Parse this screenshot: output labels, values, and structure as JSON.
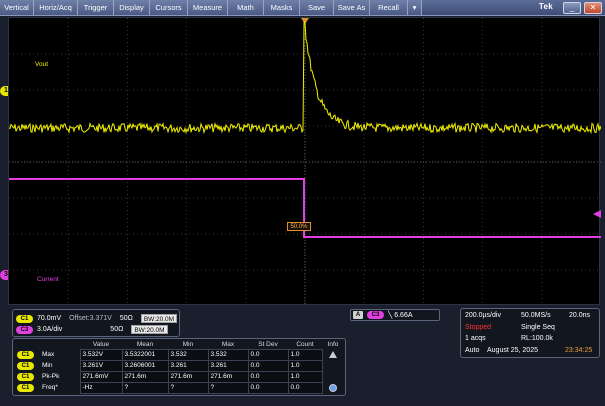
{
  "menu": {
    "items": [
      "Vertical",
      "Horiz/Acq",
      "Trigger",
      "Display",
      "Cursors",
      "Measure",
      "Math",
      "Masks",
      "Save",
      "Save As",
      "Recall"
    ],
    "more": "▾"
  },
  "window": {
    "brand": "Tek",
    "minimize": "_",
    "close": "✕"
  },
  "markers": {
    "ch1": "1",
    "ch3": "3"
  },
  "waveforms": {
    "vout_label": "Vout",
    "current_label": "Current",
    "trigger_position": "50.0%",
    "colors": {
      "ch1": "#f0f000",
      "ch3": "#e040e0",
      "trigger": "#e09030"
    }
  },
  "channels": {
    "c1": {
      "badge": "C1",
      "scale": "70.0mV",
      "offset": "Offset:3.371V",
      "impedance": "50Ω",
      "bw": "BW:20.0M"
    },
    "c3": {
      "badge": "C3",
      "scale": "3.0A/div",
      "impedance": "50Ω",
      "bw": "BW:20.0M"
    }
  },
  "trigger": {
    "source_badge": "A",
    "channel_badge": "C3",
    "slope": "╲",
    "level": "6.66A"
  },
  "acquisition": {
    "timebase": "200.0µs/div",
    "sample_rate": "50.0MS/s",
    "resolution": "20.0ns",
    "state": "Stopped",
    "mode": "Single Seq",
    "acqs": "1 acqs",
    "record_length": "RL:100.0k",
    "trigger_mode": "Auto",
    "date": "August 25, 2025",
    "time": "23:34:25"
  },
  "measurements": {
    "headers": [
      "Value",
      "Mean",
      "Min",
      "Max",
      "St Dev",
      "Count",
      "Info"
    ],
    "rows": [
      {
        "badge": "C1",
        "name": "Max",
        "value": "3.532V",
        "mean": "3.5322001",
        "min": "3.532",
        "max": "3.532",
        "stdev": "0.0",
        "count": "1.0"
      },
      {
        "badge": "C1",
        "name": "Min",
        "value": "3.261V",
        "mean": "3.2606001",
        "min": "3.261",
        "max": "3.261",
        "stdev": "0.0",
        "count": "1.0"
      },
      {
        "badge": "C1",
        "name": "Pk-Pk",
        "value": "271.6mV",
        "mean": "271.6m",
        "min": "271.6m",
        "max": "271.6m",
        "stdev": "0.0",
        "count": "1.0"
      },
      {
        "badge": "C1",
        "name": "Freq*",
        "value": "-Hz",
        "mean": "?",
        "min": "?",
        "max": "?",
        "stdev": "0.0",
        "count": "0.0"
      }
    ]
  }
}
